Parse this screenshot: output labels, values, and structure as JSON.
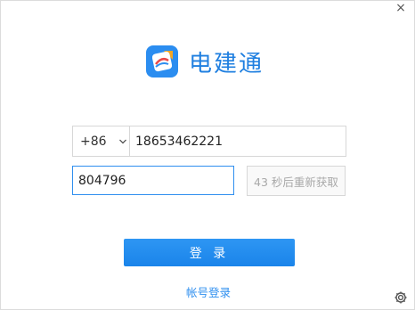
{
  "window": {
    "close_glyph": "×"
  },
  "brand": {
    "title": "电建通",
    "logo_icon": "dianjiantong-logo-icon",
    "accent": "#1f7fe0"
  },
  "form": {
    "country_code": "+86",
    "phone": "18653462221",
    "verification_code": "804796",
    "resend_label": "43 秒后重新获取"
  },
  "actions": {
    "login_label": "登 录",
    "account_login_link": "帐号登录"
  },
  "icons": {
    "close": "close-icon",
    "chevron": "chevron-down-icon",
    "settings": "gear-icon"
  },
  "colors": {
    "primary": "#1a84ea",
    "focus_border": "#2f8fef",
    "disabled_text": "#a8a8a8"
  }
}
